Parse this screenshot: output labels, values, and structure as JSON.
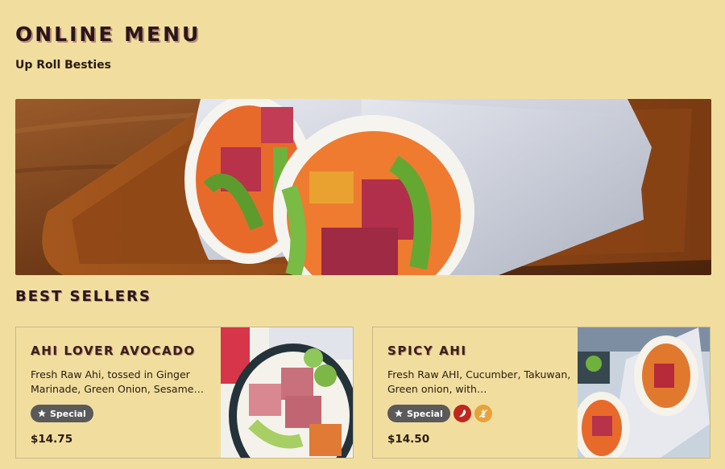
{
  "header": {
    "title": "ONLINE MENU",
    "subtitle": "Up Roll Besties"
  },
  "best_sellers": {
    "title": "BEST SELLERS",
    "items": [
      {
        "name": "AHI LOVER AVOCADO",
        "description": "Fresh Raw Ahi, tossed in Ginger Marinade, Green Onion, Sesame…",
        "badge": "Special",
        "price": "$14.75"
      },
      {
        "name": "SPICY AHI",
        "description": "Fresh Raw AHI, Cucumber, Takuwan, Green onion, with…",
        "badge": "Special",
        "price": "$14.50"
      }
    ]
  },
  "icons": {
    "badge": "star-icon",
    "spicy": "chili-pepper-icon",
    "gluten": "wheat-icon"
  },
  "colors": {
    "background": "#f1de9f",
    "badge": "#5a5a5a",
    "spicy": "#c0271d",
    "gluten": "#e7a23a"
  }
}
